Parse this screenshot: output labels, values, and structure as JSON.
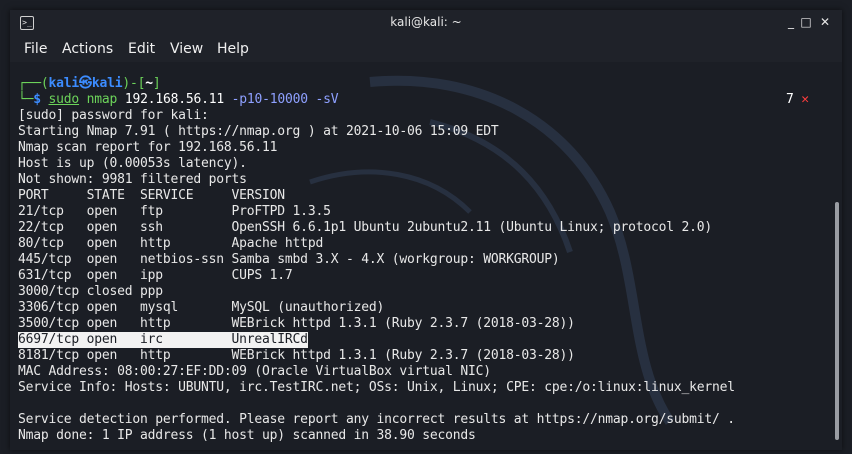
{
  "window": {
    "title": "kali@kali: ~",
    "controls": {
      "minimize": "_",
      "maximize": "□",
      "close": "✕"
    },
    "icon": "terminal-icon"
  },
  "menu": [
    "File",
    "Actions",
    "Edit",
    "View",
    "Help"
  ],
  "prompt": {
    "open": "┌──(",
    "user": "kali",
    "at": "㉿",
    "host": "kali",
    "mid": ")-[",
    "dir": "~",
    "close": "]",
    "second": "└─",
    "dollar": "$ ",
    "sudo": "sudo",
    "cmd": " nmap ",
    "target": "192.168.56.11",
    "args": " -p10-10000 -sV",
    "exit_code": "7",
    "exit_mark": "✕"
  },
  "output": [
    "[sudo] password for kali:",
    "Starting Nmap 7.91 ( https://nmap.org ) at 2021-10-06 15:09 EDT",
    "Nmap scan report for 192.168.56.11",
    "Host is up (0.00053s latency).",
    "Not shown: 9981 filtered ports",
    "PORT     STATE  SERVICE     VERSION",
    "21/tcp   open   ftp         ProFTPD 1.3.5",
    "22/tcp   open   ssh         OpenSSH 6.6.1p1 Ubuntu 2ubuntu2.11 (Ubuntu Linux; protocol 2.0)",
    "80/tcp   open   http        Apache httpd",
    "445/tcp  open   netbios-ssn Samba smbd 3.X - 4.X (workgroup: WORKGROUP)",
    "631/tcp  open   ipp         CUPS 1.7",
    "3000/tcp closed ppp",
    "3306/tcp open   mysql       MySQL (unauthorized)",
    "3500/tcp open   http        WEBrick httpd 1.3.1 (Ruby 2.3.7 (2018-03-28))",
    "6697/tcp open   irc         UnrealIRCd",
    "8181/tcp open   http        WEBrick httpd 1.3.1 (Ruby 2.3.7 (2018-03-28))",
    "MAC Address: 08:00:27:EF:DD:09 (Oracle VirtualBox virtual NIC)",
    "Service Info: Hosts: UBUNTU, irc.TestIRC.net; OSs: Unix, Linux; CPE: cpe:/o:linux:linux_kernel",
    "",
    "Service detection performed. Please report any incorrect results at https://nmap.org/submit/ .",
    "Nmap done: 1 IP address (1 host up) scanned in 38.90 seconds"
  ]
}
